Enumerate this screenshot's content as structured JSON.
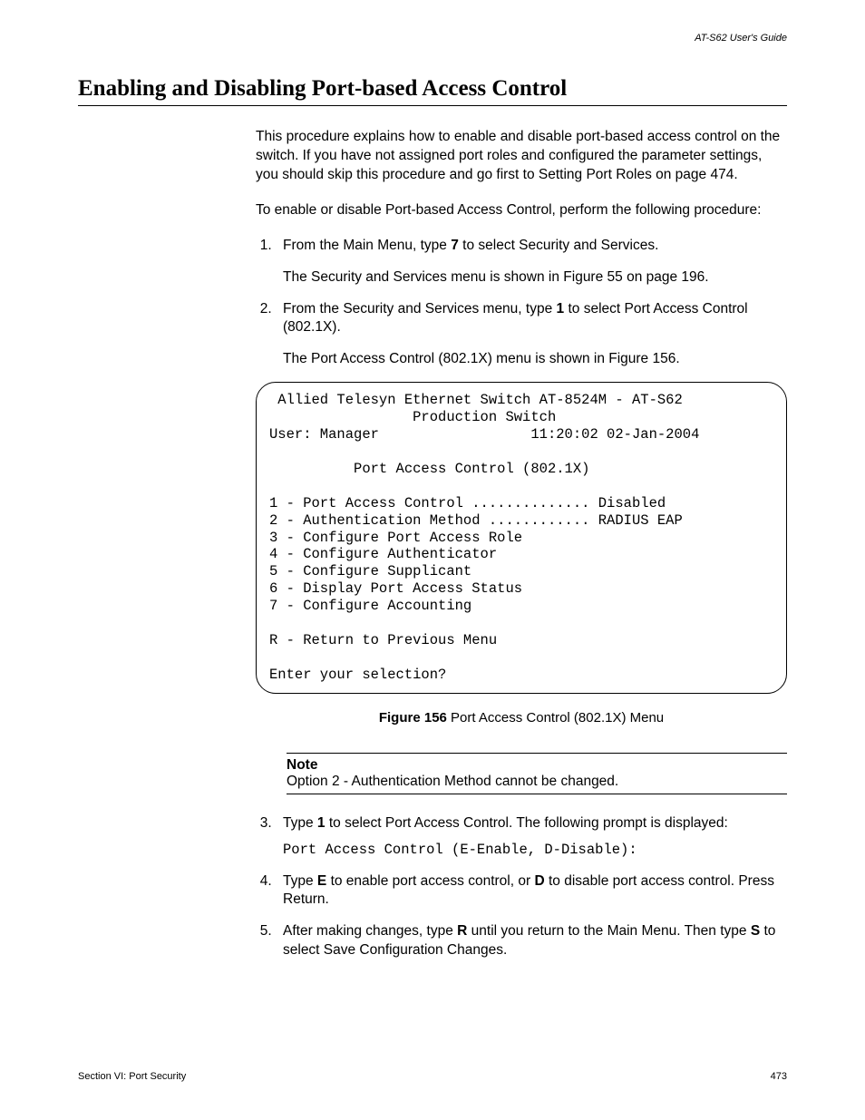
{
  "header": {
    "right": "AT-S62 User's Guide"
  },
  "title": "Enabling and Disabling Port-based Access Control",
  "intro1": "This procedure explains how to enable and disable port-based access control on the switch. If you have not assigned port roles and configured the parameter settings, you should skip this procedure and go first to Setting Port Roles on page 474.",
  "intro2": "To enable or disable Port-based Access Control, perform the following procedure:",
  "steps": {
    "s1a": "From the Main Menu, type ",
    "s1b": "7",
    "s1c": " to select Security and Services.",
    "s1sub": "The Security and Services menu is shown in Figure 55 on page 196.",
    "s2a": "From the Security and Services menu, type ",
    "s2b": "1",
    "s2c": " to select Port Access Control (802.1X).",
    "s2sub": "The Port Access Control (802.1X) menu is shown in Figure 156.",
    "s3a": "Type ",
    "s3b": "1",
    "s3c": " to select Port Access Control. The following prompt is displayed:",
    "s3prompt": "Port Access Control (E-Enable, D-Disable):",
    "s4a": "Type ",
    "s4b": "E",
    "s4c": " to enable port access control, or ",
    "s4d": "D",
    "s4e": " to disable port access control. Press Return.",
    "s5a": "After making changes, type ",
    "s5b": "R",
    "s5c": " until you return to the Main Menu. Then type ",
    "s5d": "S",
    "s5e": " to select Save Configuration Changes."
  },
  "terminal": " Allied Telesyn Ethernet Switch AT-8524M - AT-S62\n                 Production Switch\nUser: Manager                  11:20:02 02-Jan-2004\n\n          Port Access Control (802.1X)\n\n1 - Port Access Control .............. Disabled\n2 - Authentication Method ............ RADIUS EAP\n3 - Configure Port Access Role\n4 - Configure Authenticator\n5 - Configure Supplicant\n6 - Display Port Access Status\n7 - Configure Accounting\n\nR - Return to Previous Menu\n\nEnter your selection?",
  "figure": {
    "label": "Figure 156",
    "caption": "  Port Access Control (802.1X) Menu"
  },
  "note": {
    "title": "Note",
    "text": "Option 2 - Authentication Method cannot be changed."
  },
  "footer": {
    "left": "Section VI: Port Security",
    "right": "473"
  }
}
